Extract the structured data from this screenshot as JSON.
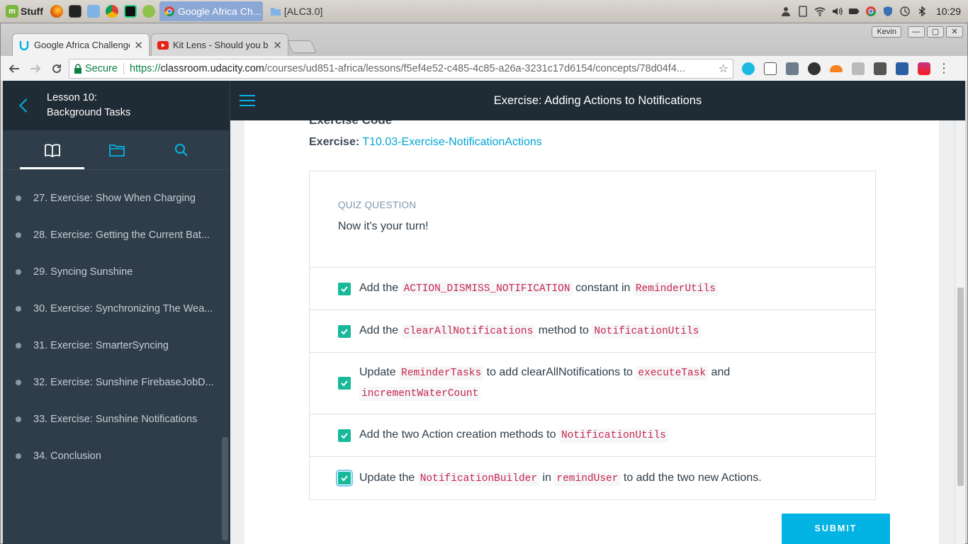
{
  "os": {
    "menu_label": "Stuff",
    "taskbar": [
      {
        "label": "Google Africa Ch...",
        "active": true
      },
      {
        "label": "[ALC3.0]",
        "active": false
      }
    ],
    "clock": "10:29"
  },
  "browser": {
    "profile": "Kevin",
    "tabs": [
      {
        "title": "Google Africa Challenge",
        "active": true
      },
      {
        "title": "Kit Lens - Should you bu",
        "active": false
      }
    ],
    "secure_label": "Secure",
    "url_scheme": "https://",
    "url_host": "classroom.udacity.com",
    "url_path": "/courses/ud851-africa/lessons/f5ef4e52-c485-4c85-a26a-3231c17d6154/concepts/78d04f4..."
  },
  "sidebar": {
    "lesson_line1": "Lesson 10:",
    "lesson_line2": "Background Tasks",
    "concepts": [
      "27. Exercise: Show When Charging",
      "28. Exercise: Getting the Current Bat...",
      "29. Syncing Sunshine",
      "30. Exercise: Synchronizing The Wea...",
      "31. Exercise: SmarterSyncing",
      "32. Exercise: Sunshine FirebaseJobD...",
      "33. Exercise: Sunshine Notifications",
      "34. Conclusion"
    ]
  },
  "header": {
    "title": "Exercise: Adding Actions to Notifications"
  },
  "content": {
    "exercise_heading": "Exercise Code",
    "exercise_label": "Exercise:",
    "exercise_link": "T10.03-Exercise-NotificationActions",
    "quiz_label": "QUIZ QUESTION",
    "quiz_prompt": "Now it's your turn!",
    "options": [
      {
        "checked": true,
        "parts": [
          "Add the ",
          "ACTION_DISMISS_NOTIFICATION",
          " constant in ",
          "ReminderUtils"
        ]
      },
      {
        "checked": true,
        "parts": [
          "Add the ",
          "clearAllNotifications",
          " method to ",
          "NotificationUtils"
        ]
      },
      {
        "checked": true,
        "parts": [
          "Update ",
          "ReminderTasks",
          " to add clearAllNotifications to ",
          "executeTask",
          " and ",
          "incrementWaterCount"
        ]
      },
      {
        "checked": true,
        "parts": [
          "Add the two Action creation methods to ",
          "NotificationUtils"
        ]
      },
      {
        "checked": true,
        "parts": [
          "Update the ",
          "NotificationBuilder",
          " in ",
          "remindUser",
          " to add the two new Actions."
        ]
      }
    ],
    "submit_label": "SUBMIT"
  },
  "colors": {
    "accent": "#02b3e4",
    "checkbox": "#17b99a",
    "sidebar_bg": "#2e3d49",
    "header_bg": "#1f2b35",
    "code_text": "#c7254e"
  }
}
